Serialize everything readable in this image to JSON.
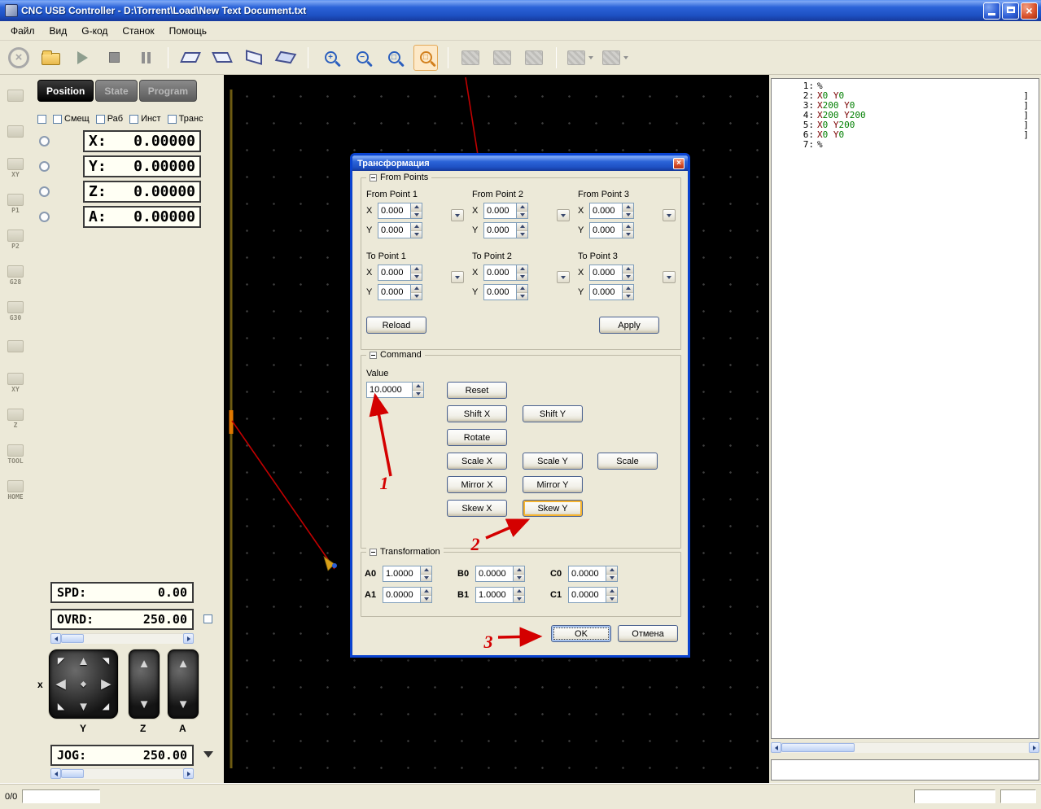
{
  "window": {
    "title": "CNC USB Controller - D:\\Torrent\\Load\\New Text Document.txt"
  },
  "menubar": {
    "items": [
      "Файл",
      "Вид",
      "G-код",
      "Станок",
      "Помощь"
    ]
  },
  "toolbar": {
    "buttons": [
      {
        "name": "abort",
        "icon": "abort-icon"
      },
      {
        "name": "open-file",
        "icon": "folder-icon"
      },
      {
        "name": "start",
        "icon": "play-icon"
      },
      {
        "name": "stop",
        "icon": "stop-icon"
      },
      {
        "name": "pause",
        "icon": "pause-icon"
      },
      {
        "sep": true
      },
      {
        "name": "view-plane-1",
        "icon": "plane-icon-1"
      },
      {
        "name": "view-plane-2",
        "icon": "plane-icon-2"
      },
      {
        "name": "view-plane-3",
        "icon": "plane-icon-3"
      },
      {
        "name": "view-plane-4",
        "icon": "plane-icon-4"
      },
      {
        "sep": true
      },
      {
        "name": "zoom-in",
        "icon": "zoom-in-icon"
      },
      {
        "name": "zoom-out",
        "icon": "zoom-out-icon"
      },
      {
        "name": "zoom-extents",
        "icon": "zoom-extents-icon"
      },
      {
        "name": "zoom-window",
        "icon": "zoom-window-icon",
        "selected": true
      },
      {
        "sep": true
      },
      {
        "name": "machine-tool-1",
        "icon": "machine-icon-1"
      },
      {
        "name": "machine-tool-2",
        "icon": "machine-icon-2"
      },
      {
        "name": "machine-tool-3",
        "icon": "machine-icon-3"
      },
      {
        "sep": true
      },
      {
        "name": "machine-tool-4",
        "icon": "machine-icon-4",
        "drop": true
      },
      {
        "name": "machine-tool-5",
        "icon": "machine-icon-5",
        "drop": true
      }
    ]
  },
  "side_toolbar": {
    "items": [
      "",
      "",
      "XY",
      "P1",
      "P2",
      "G28",
      "G30",
      "",
      "XY",
      "Z",
      "TOOL",
      "HOME"
    ]
  },
  "position_panel": {
    "tabs": [
      {
        "label": "Position",
        "active": true
      },
      {
        "label": "State",
        "active": false
      },
      {
        "label": "Program",
        "active": false
      }
    ],
    "option_checkboxes": [
      "Смещ",
      "Раб",
      "Инст",
      "Транс"
    ],
    "axes": [
      {
        "label": "X:",
        "value": "0.00000"
      },
      {
        "label": "Y:",
        "value": "0.00000"
      },
      {
        "label": "Z:",
        "value": "0.00000"
      },
      {
        "label": "A:",
        "value": "0.00000"
      }
    ],
    "spd_label": "SPD:",
    "spd_value": "0.00",
    "ovrd_label": "OVRD:",
    "ovrd_value": "250.00",
    "jog_label": "JOG:",
    "jog_value": "250.00",
    "pad_labels": {
      "x": "x",
      "y": "Y",
      "z": "Z",
      "a": "A"
    }
  },
  "dialog": {
    "title": "Трансформация",
    "from_points_group": "From Points",
    "axis_x_label": "X",
    "axis_y_label": "Y",
    "from_points": [
      {
        "label": "From Point 1",
        "x": "0.000",
        "y": "0.000"
      },
      {
        "label": "From Point 2",
        "x": "0.000",
        "y": "0.000"
      },
      {
        "label": "From Point 3",
        "x": "0.000",
        "y": "0.000"
      }
    ],
    "to_points": [
      {
        "label": "To Point 1",
        "x": "0.000",
        "y": "0.000"
      },
      {
        "label": "To Point 2",
        "x": "0.000",
        "y": "0.000"
      },
      {
        "label": "To Point 3",
        "x": "0.000",
        "y": "0.000"
      }
    ],
    "reload_button": "Reload",
    "apply_button": "Apply",
    "command_group": "Command",
    "value_label": "Value",
    "value": "10.0000",
    "command_buttons": [
      "Reset",
      "Shift X",
      "Shift Y",
      "Rotate",
      "Scale X",
      "Scale Y",
      "Scale",
      "Mirror X",
      "Mirror Y",
      "Skew X",
      "Skew Y"
    ],
    "transformation_group": "Transformation",
    "matrix": [
      {
        "label": "A0",
        "value": "1.0000"
      },
      {
        "label": "B0",
        "value": "0.0000"
      },
      {
        "label": "C0",
        "value": "0.0000"
      },
      {
        "label": "A1",
        "value": "0.0000"
      },
      {
        "label": "B1",
        "value": "1.0000"
      },
      {
        "label": "C1",
        "value": "0.0000"
      }
    ],
    "ok_button": "OK",
    "cancel_button": "Отмена"
  },
  "gcode_panel": {
    "lines": [
      {
        "num": "1:",
        "parts": [
          {
            "t": "%",
            "c": "p"
          }
        ],
        "bracket": ""
      },
      {
        "num": "2:",
        "parts": [
          {
            "t": "X",
            "c": "w"
          },
          {
            "t": "0 ",
            "c": "n"
          },
          {
            "t": "Y",
            "c": "w"
          },
          {
            "t": "0",
            "c": "n"
          }
        ],
        "bracket": "]"
      },
      {
        "num": "3:",
        "parts": [
          {
            "t": "X",
            "c": "w"
          },
          {
            "t": "200 ",
            "c": "n"
          },
          {
            "t": "Y",
            "c": "w"
          },
          {
            "t": "0",
            "c": "n"
          }
        ],
        "bracket": "]"
      },
      {
        "num": "4:",
        "parts": [
          {
            "t": "X",
            "c": "w"
          },
          {
            "t": "200 ",
            "c": "n"
          },
          {
            "t": "Y",
            "c": "w"
          },
          {
            "t": "200",
            "c": "n"
          }
        ],
        "bracket": "]"
      },
      {
        "num": "5:",
        "parts": [
          {
            "t": "X",
            "c": "w"
          },
          {
            "t": "0 ",
            "c": "n"
          },
          {
            "t": "Y",
            "c": "w"
          },
          {
            "t": "200",
            "c": "n"
          }
        ],
        "bracket": "]"
      },
      {
        "num": "6:",
        "parts": [
          {
            "t": "X",
            "c": "w"
          },
          {
            "t": "0 ",
            "c": "n"
          },
          {
            "t": "Y",
            "c": "w"
          },
          {
            "t": "0",
            "c": "n"
          }
        ],
        "bracket": "]"
      },
      {
        "num": "7:",
        "parts": [
          {
            "t": "%",
            "c": "p"
          }
        ],
        "bracket": ""
      }
    ]
  },
  "annotations": [
    {
      "label": "1"
    },
    {
      "label": "2"
    },
    {
      "label": "3"
    }
  ],
  "statusbar": {
    "counter": "0/0"
  },
  "colors": {
    "accent_blue": "#1E51C4",
    "annotation_red": "#D40000",
    "gcode_number_green": "#007F00",
    "canvas_black": "#000000"
  }
}
